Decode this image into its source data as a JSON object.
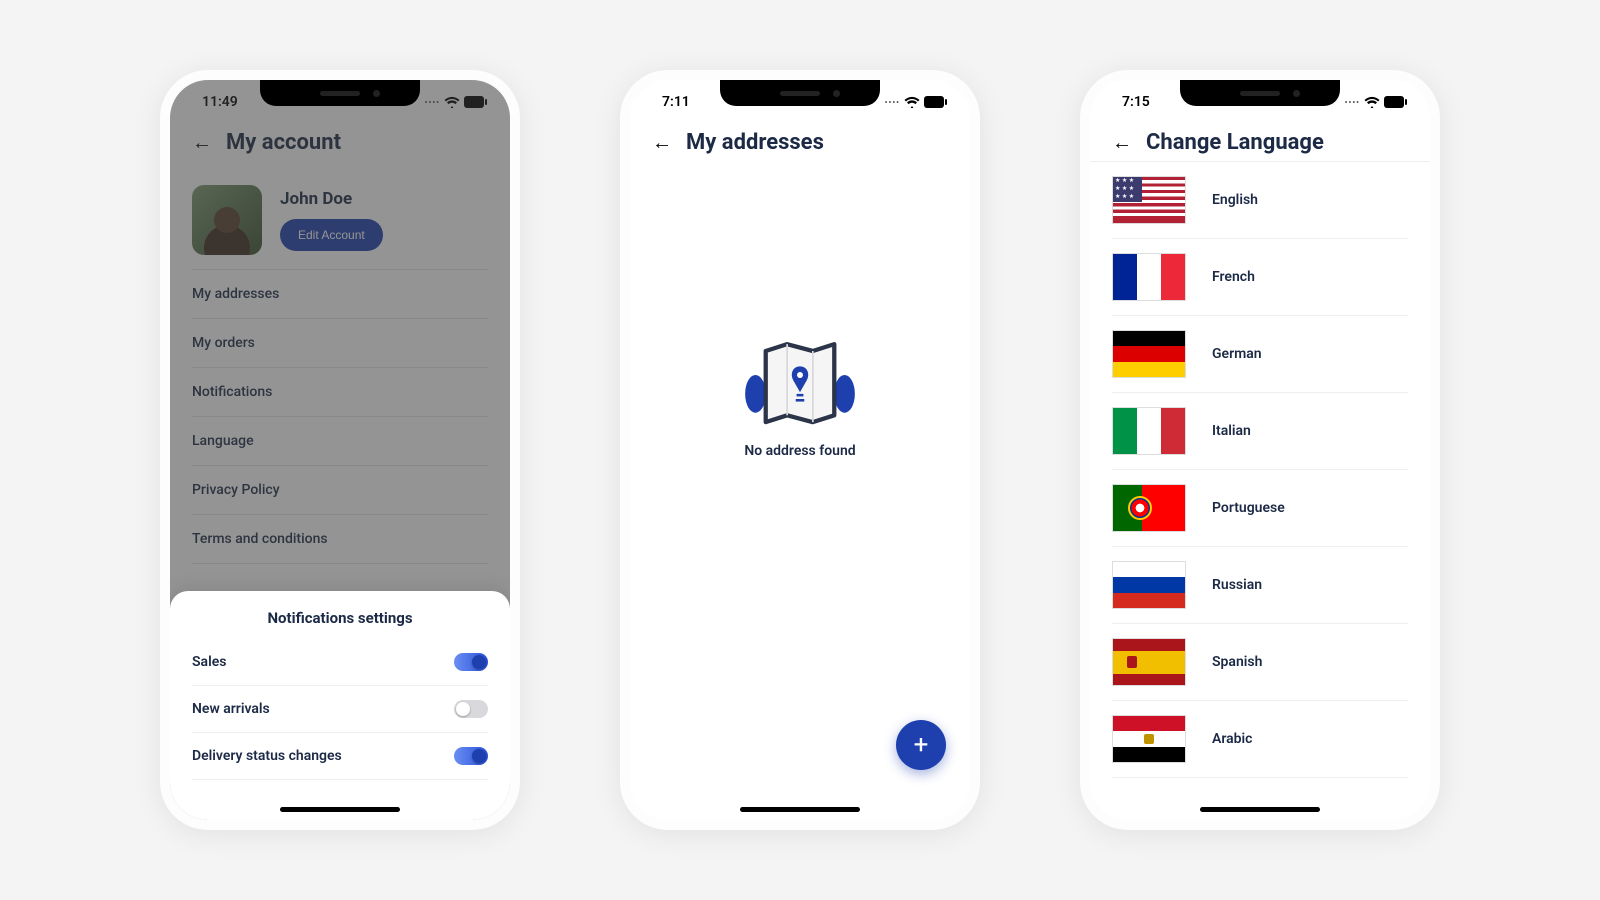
{
  "phone1": {
    "status_time": "11:49",
    "header_title": "My account",
    "profile_name": "John Doe",
    "edit_button": "Edit Account",
    "menu_items": [
      "My addresses",
      "My orders",
      "Notifications",
      "Language",
      "Privacy Policy",
      "Terms and conditions"
    ],
    "sheet_title": "Notifications settings",
    "toggles": [
      {
        "label": "Sales",
        "on": true
      },
      {
        "label": "New arrivals",
        "on": false
      },
      {
        "label": "Delivery status changes",
        "on": true
      }
    ]
  },
  "phone2": {
    "status_time": "7:11",
    "header_title": "My addresses",
    "empty_text": "No address found",
    "fab_label": "+"
  },
  "phone3": {
    "status_time": "7:15",
    "header_title": "Change Language",
    "languages": [
      {
        "label": "English",
        "flag": "us"
      },
      {
        "label": "French",
        "flag": "fr"
      },
      {
        "label": "German",
        "flag": "de"
      },
      {
        "label": "Italian",
        "flag": "it"
      },
      {
        "label": "Portuguese",
        "flag": "pt"
      },
      {
        "label": "Russian",
        "flag": "ru"
      },
      {
        "label": "Spanish",
        "flag": "es"
      },
      {
        "label": "Arabic",
        "flag": "eg"
      }
    ]
  }
}
